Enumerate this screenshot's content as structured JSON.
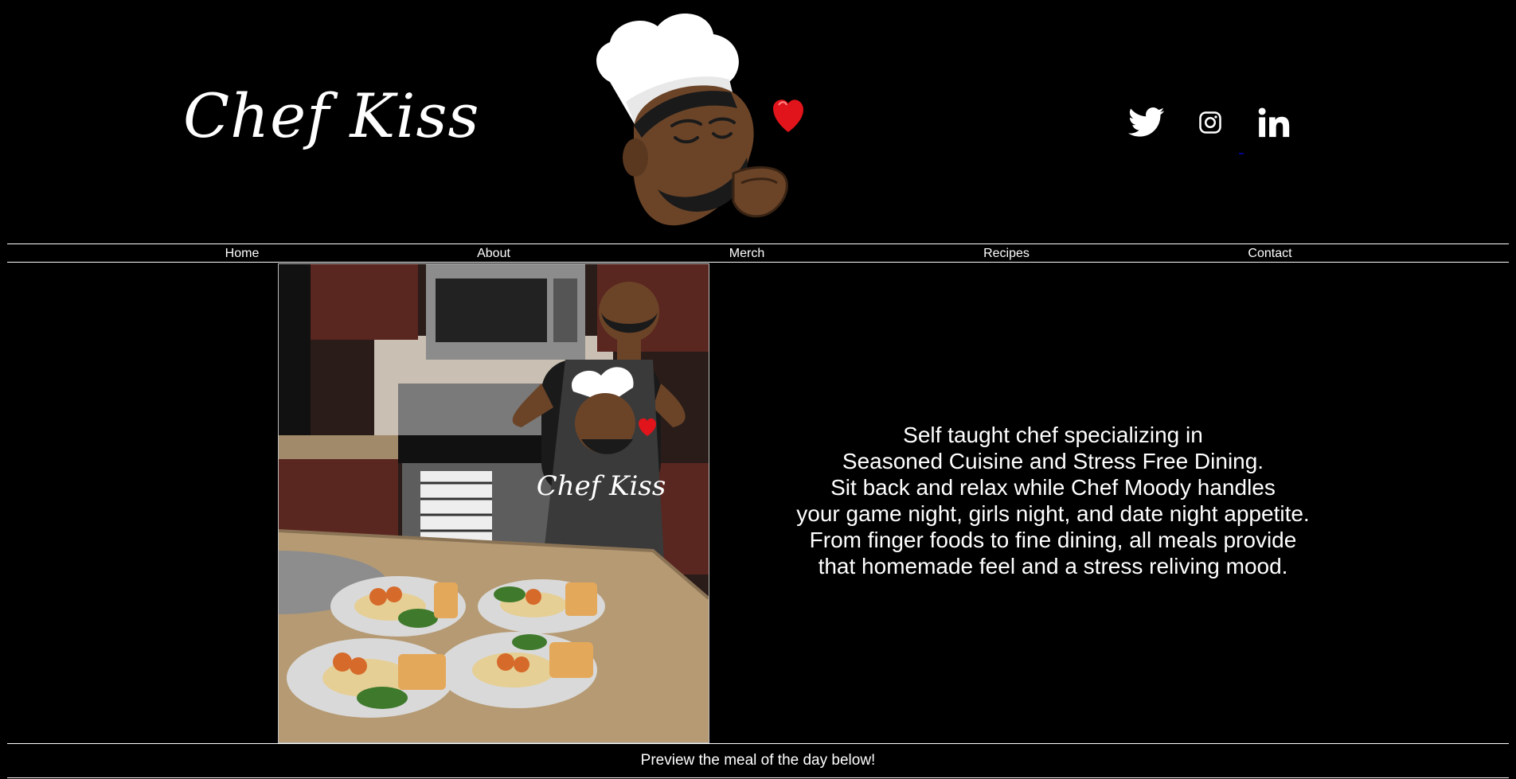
{
  "header": {
    "brand": "Chef Kiss",
    "mascot_icon": "chef-kiss-mascot",
    "socials": [
      {
        "name": "twitter",
        "icon": "twitter-icon"
      },
      {
        "name": "instagram",
        "icon": "instagram-icon"
      },
      {
        "name": "linkedin",
        "icon": "linkedin-icon"
      }
    ]
  },
  "nav": {
    "items": [
      "Home",
      "About",
      "Merch",
      "Recipes",
      "Contact"
    ]
  },
  "hero": {
    "photo_apron_text": "Chef Kiss",
    "intro_lines": [
      "Self taught chef specializing in",
      "Seasoned Cuisine and Stress Free Dining.",
      "Sit back and relax while Chef Moody handles",
      "your game night, girls night, and date night appetite.",
      "From finger foods to fine dining, all meals provide",
      "that homemade feel and a stress reliving mood."
    ]
  },
  "footer": {
    "text": "Preview the meal of the day below!"
  },
  "colors": {
    "background": "#000000",
    "text": "#ffffff",
    "heart": "#e0141a",
    "skin": "#6b4428"
  }
}
